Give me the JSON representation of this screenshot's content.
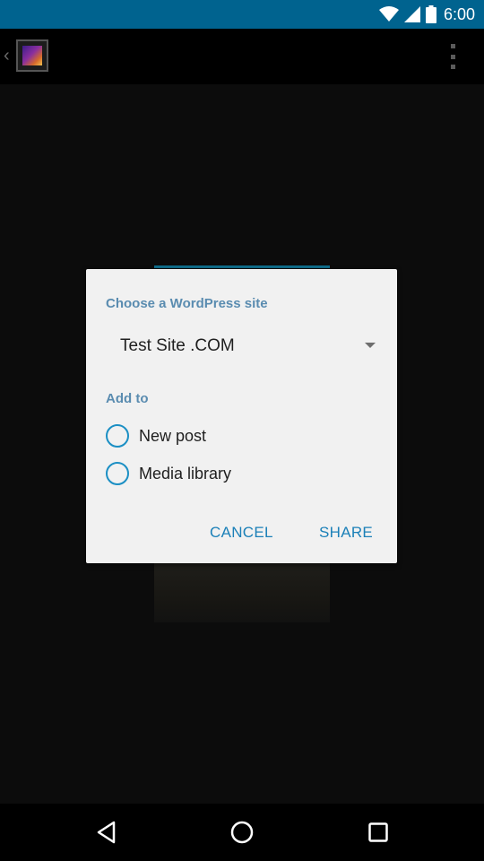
{
  "status_bar": {
    "time": "6:00",
    "icons": [
      "wifi-icon",
      "signal-icon",
      "battery-icon"
    ],
    "color": "#00638f"
  },
  "action_bar": {
    "icons": [
      "up-chevron-icon",
      "app-icon",
      "overflow-menu-icon"
    ]
  },
  "dialog": {
    "site_label": "Choose a WordPress site",
    "selected_site": "Test Site .COM",
    "add_to_label": "Add to",
    "options": [
      {
        "label": "New post",
        "selected": false
      },
      {
        "label": "Media library",
        "selected": false
      }
    ],
    "cancel_label": "CANCEL",
    "share_label": "SHARE",
    "accent_color": "#1b8fc4",
    "header_color": "#5a8cb0"
  },
  "nav_bar": {
    "icons": [
      "back-icon",
      "home-icon",
      "recent-apps-icon"
    ]
  }
}
